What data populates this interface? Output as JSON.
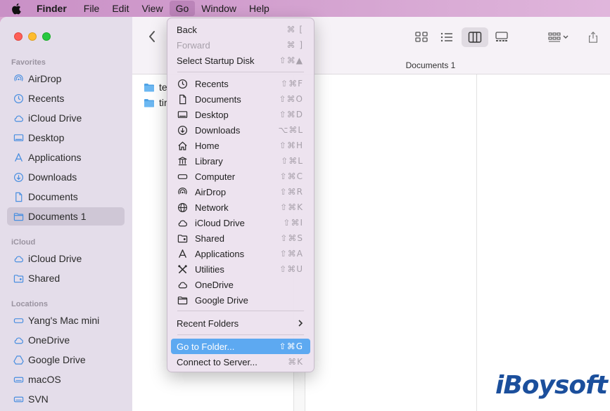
{
  "menubar": {
    "app": "Finder",
    "items": [
      "File",
      "Edit",
      "View",
      "Go",
      "Window",
      "Help"
    ],
    "active": "Go"
  },
  "sidebar": {
    "favorites_label": "Favorites",
    "favorites": [
      {
        "label": "AirDrop",
        "icon": "airdrop-icon"
      },
      {
        "label": "Recents",
        "icon": "clock-icon"
      },
      {
        "label": "iCloud Drive",
        "icon": "cloud-icon"
      },
      {
        "label": "Desktop",
        "icon": "desktop-icon"
      },
      {
        "label": "Applications",
        "icon": "applications-icon"
      },
      {
        "label": "Downloads",
        "icon": "download-icon"
      },
      {
        "label": "Documents",
        "icon": "document-icon"
      },
      {
        "label": "Documents 1",
        "icon": "folder-icon",
        "selected": true
      }
    ],
    "icloud_label": "iCloud",
    "icloud": [
      {
        "label": "iCloud Drive",
        "icon": "cloud-icon"
      },
      {
        "label": "Shared",
        "icon": "shared-folder-icon"
      }
    ],
    "locations_label": "Locations",
    "locations": [
      {
        "label": "Yang's Mac mini",
        "icon": "computer-icon"
      },
      {
        "label": "OneDrive",
        "icon": "cloud-icon"
      },
      {
        "label": "Google Drive",
        "icon": "drive-icon"
      },
      {
        "label": "macOS",
        "icon": "disk-icon"
      },
      {
        "label": "SVN",
        "icon": "disk-icon"
      }
    ]
  },
  "toolbar": {
    "path_title": "Documents 1"
  },
  "files": [
    "te",
    "tir"
  ],
  "go_menu": {
    "top": [
      {
        "label": "Back",
        "shortcut": "⌘ [",
        "disabled": false
      },
      {
        "label": "Forward",
        "shortcut": "⌘ ]",
        "disabled": true
      },
      {
        "label": "Select Startup Disk",
        "shortcut": "⇧⌘▲",
        "disabled": false
      }
    ],
    "places": [
      {
        "label": "Recents",
        "shortcut": "⇧⌘F",
        "icon": "clock-icon"
      },
      {
        "label": "Documents",
        "shortcut": "⇧⌘O",
        "icon": "document-icon"
      },
      {
        "label": "Desktop",
        "shortcut": "⇧⌘D",
        "icon": "desktop-icon"
      },
      {
        "label": "Downloads",
        "shortcut": "⌥⌘L",
        "icon": "download-icon"
      },
      {
        "label": "Home",
        "shortcut": "⇧⌘H",
        "icon": "home-icon"
      },
      {
        "label": "Library",
        "shortcut": "⇧⌘L",
        "icon": "library-icon"
      },
      {
        "label": "Computer",
        "shortcut": "⇧⌘C",
        "icon": "computer-icon"
      },
      {
        "label": "AirDrop",
        "shortcut": "⇧⌘R",
        "icon": "airdrop-icon"
      },
      {
        "label": "Network",
        "shortcut": "⇧⌘K",
        "icon": "globe-icon"
      },
      {
        "label": "iCloud Drive",
        "shortcut": "⇧⌘I",
        "icon": "cloud-icon"
      },
      {
        "label": "Shared",
        "shortcut": "⇧⌘S",
        "icon": "shared-folder-icon"
      },
      {
        "label": "Applications",
        "shortcut": "⇧⌘A",
        "icon": "applications-icon"
      },
      {
        "label": "Utilities",
        "shortcut": "⇧⌘U",
        "icon": "utilities-icon"
      },
      {
        "label": "OneDrive",
        "shortcut": "",
        "icon": "cloud-icon"
      },
      {
        "label": "Google Drive",
        "shortcut": "",
        "icon": "folder-icon"
      }
    ],
    "recent_folders": "Recent Folders",
    "go_to_folder": {
      "label": "Go to Folder...",
      "shortcut": "⇧⌘G"
    },
    "connect": {
      "label": "Connect to Server...",
      "shortcut": "⌘K"
    }
  },
  "watermark": "iBoysoft"
}
